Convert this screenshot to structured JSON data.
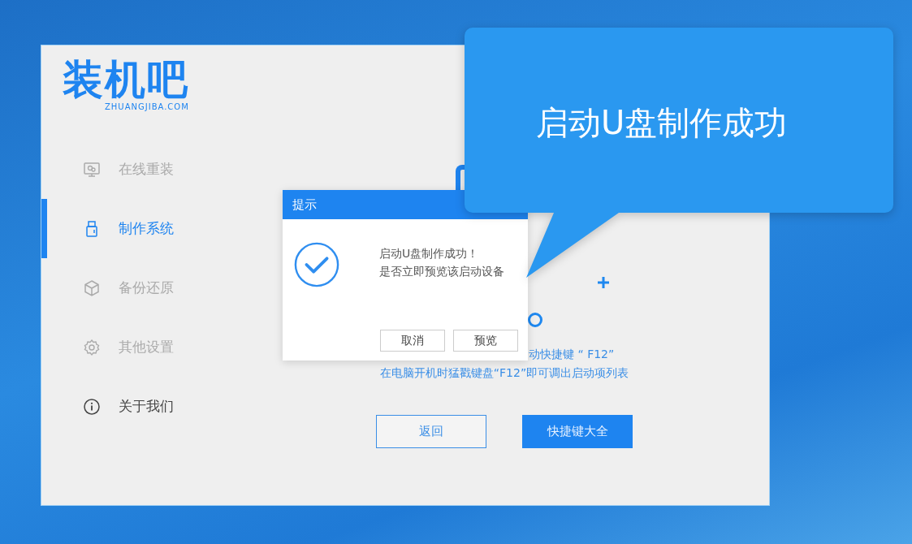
{
  "logo": {
    "name": "装机吧",
    "domain": "ZHUANGJIBA.COM"
  },
  "sidebar": {
    "items": [
      {
        "label": "在线重装",
        "kind": "monitor",
        "selected": false,
        "disabled": true
      },
      {
        "label": "制作系统",
        "kind": "usb",
        "selected": true,
        "disabled": false
      },
      {
        "label": "备份还原",
        "kind": "cube",
        "selected": false,
        "disabled": true
      },
      {
        "label": "其他设置",
        "kind": "gear",
        "selected": false,
        "disabled": true
      },
      {
        "label": "关于我们",
        "kind": "info",
        "selected": false,
        "disabled": false
      }
    ]
  },
  "content": {
    "hint_line_1": "动快捷键 “ F12”",
    "hint_line_2": "在电脑开机时猛戳键盘“F12”即可调出启动项列表",
    "buttons": [
      {
        "label": "返回",
        "kind": "secondary"
      },
      {
        "label": "快捷键大全",
        "kind": "primary"
      }
    ]
  },
  "dialog": {
    "title": "提示",
    "message_lines": [
      "启动U盘制作成功！",
      "是否立即预览该启动设备"
    ],
    "buttons": [
      "取消",
      "预览"
    ]
  },
  "callout": {
    "text": "启动U盘制作成功"
  }
}
